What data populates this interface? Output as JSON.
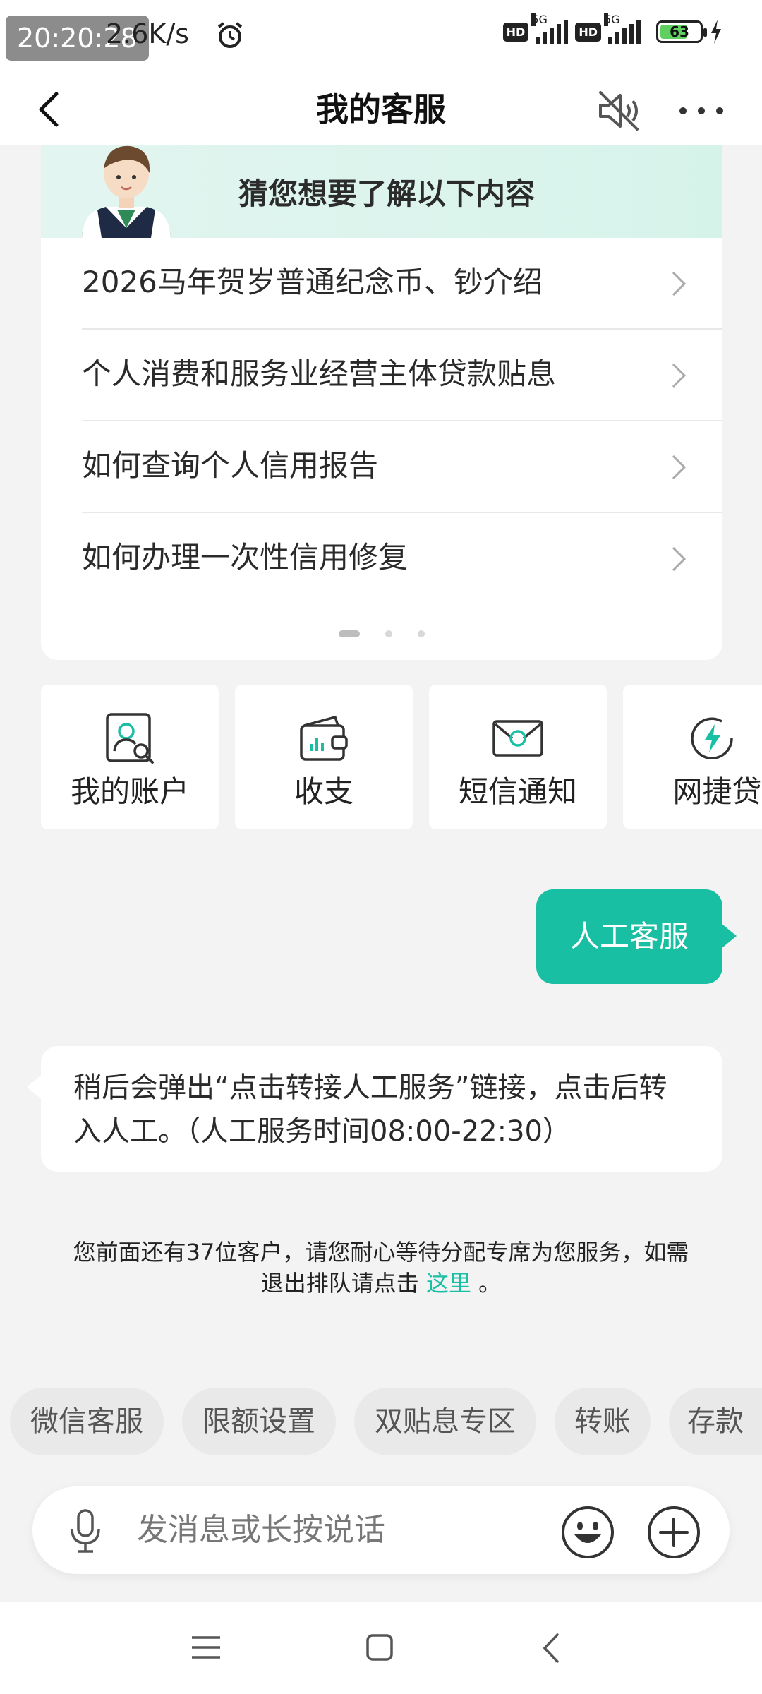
{
  "status_bar": {
    "time": "20:20:28",
    "net_speed": "2.6K/s",
    "hd_label": "HD",
    "net_type": "5G",
    "battery": "63"
  },
  "header": {
    "title": "我的客服"
  },
  "faq": {
    "banner_title": "猜您想要了解以下内容",
    "items": [
      "2026马年贺岁普通纪念币、钞介绍",
      "个人消费和服务业经营主体贷款贴息",
      "如何查询个人信用报告",
      "如何办理一次性信用修复"
    ]
  },
  "quick_actions": [
    "我的账户",
    "收支",
    "短信通知",
    "网捷贷"
  ],
  "chat": {
    "user_message": "人工客服",
    "bot_message": "稍后会弹出“点击转接人工服务”链接，点击后转入人工。（人工服务时间08:00-22:30）",
    "queue_text": "您前面还有37位客户，请您耐心等待分配专席为您服务，如需退出排队请点击",
    "queue_link": "这里",
    "queue_end": " 。"
  },
  "chips": [
    "微信客服",
    "限额设置",
    "双贴息专区",
    "转账",
    "存款"
  ],
  "input": {
    "placeholder": "发消息或长按说话"
  },
  "colors": {
    "accent": "#19bfa3",
    "banner": "#d6f3ea",
    "background": "#f3f3f3"
  }
}
